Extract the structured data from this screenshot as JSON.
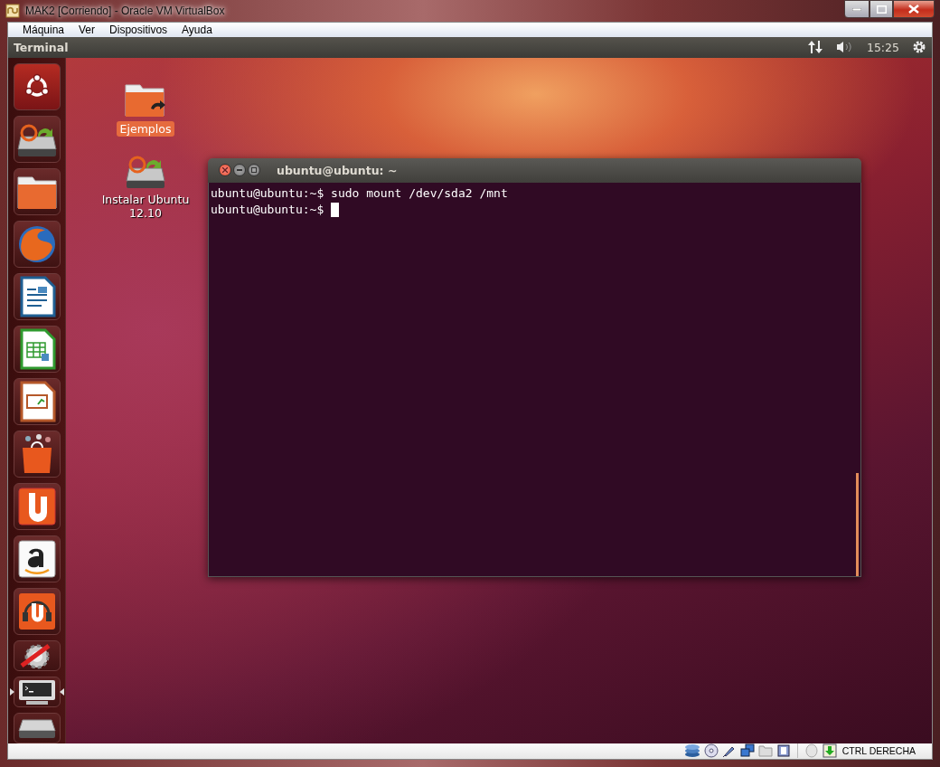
{
  "host_window": {
    "title": "MAK2 [Corriendo] - Oracle VM VirtualBox"
  },
  "menu": [
    "Máquina",
    "Ver",
    "Dispositivos",
    "Ayuda"
  ],
  "top_panel": {
    "app_name": "Terminal",
    "clock": "15:25"
  },
  "launcher": [
    {
      "active": false
    },
    {
      "active": false
    },
    {
      "active": false
    },
    {
      "active": false
    },
    {
      "active": false
    },
    {
      "active": false
    },
    {
      "active": false
    },
    {
      "active": false
    },
    {
      "active": false
    },
    {
      "active": false
    },
    {
      "active": false
    },
    {
      "active": false
    },
    {
      "active": true
    },
    {
      "active": false
    }
  ],
  "desktop_icons": [
    {
      "label": "Ejemplos",
      "selected": true
    },
    {
      "label": "Instalar Ubuntu 12.10",
      "selected": false
    }
  ],
  "terminal": {
    "title": "ubuntu@ubuntu: ~",
    "lines": [
      "ubuntu@ubuntu:~$ sudo mount /dev/sda2 /mnt",
      "ubuntu@ubuntu:~$ "
    ]
  },
  "status_bar": {
    "host_key": "CTRL DERECHA"
  }
}
